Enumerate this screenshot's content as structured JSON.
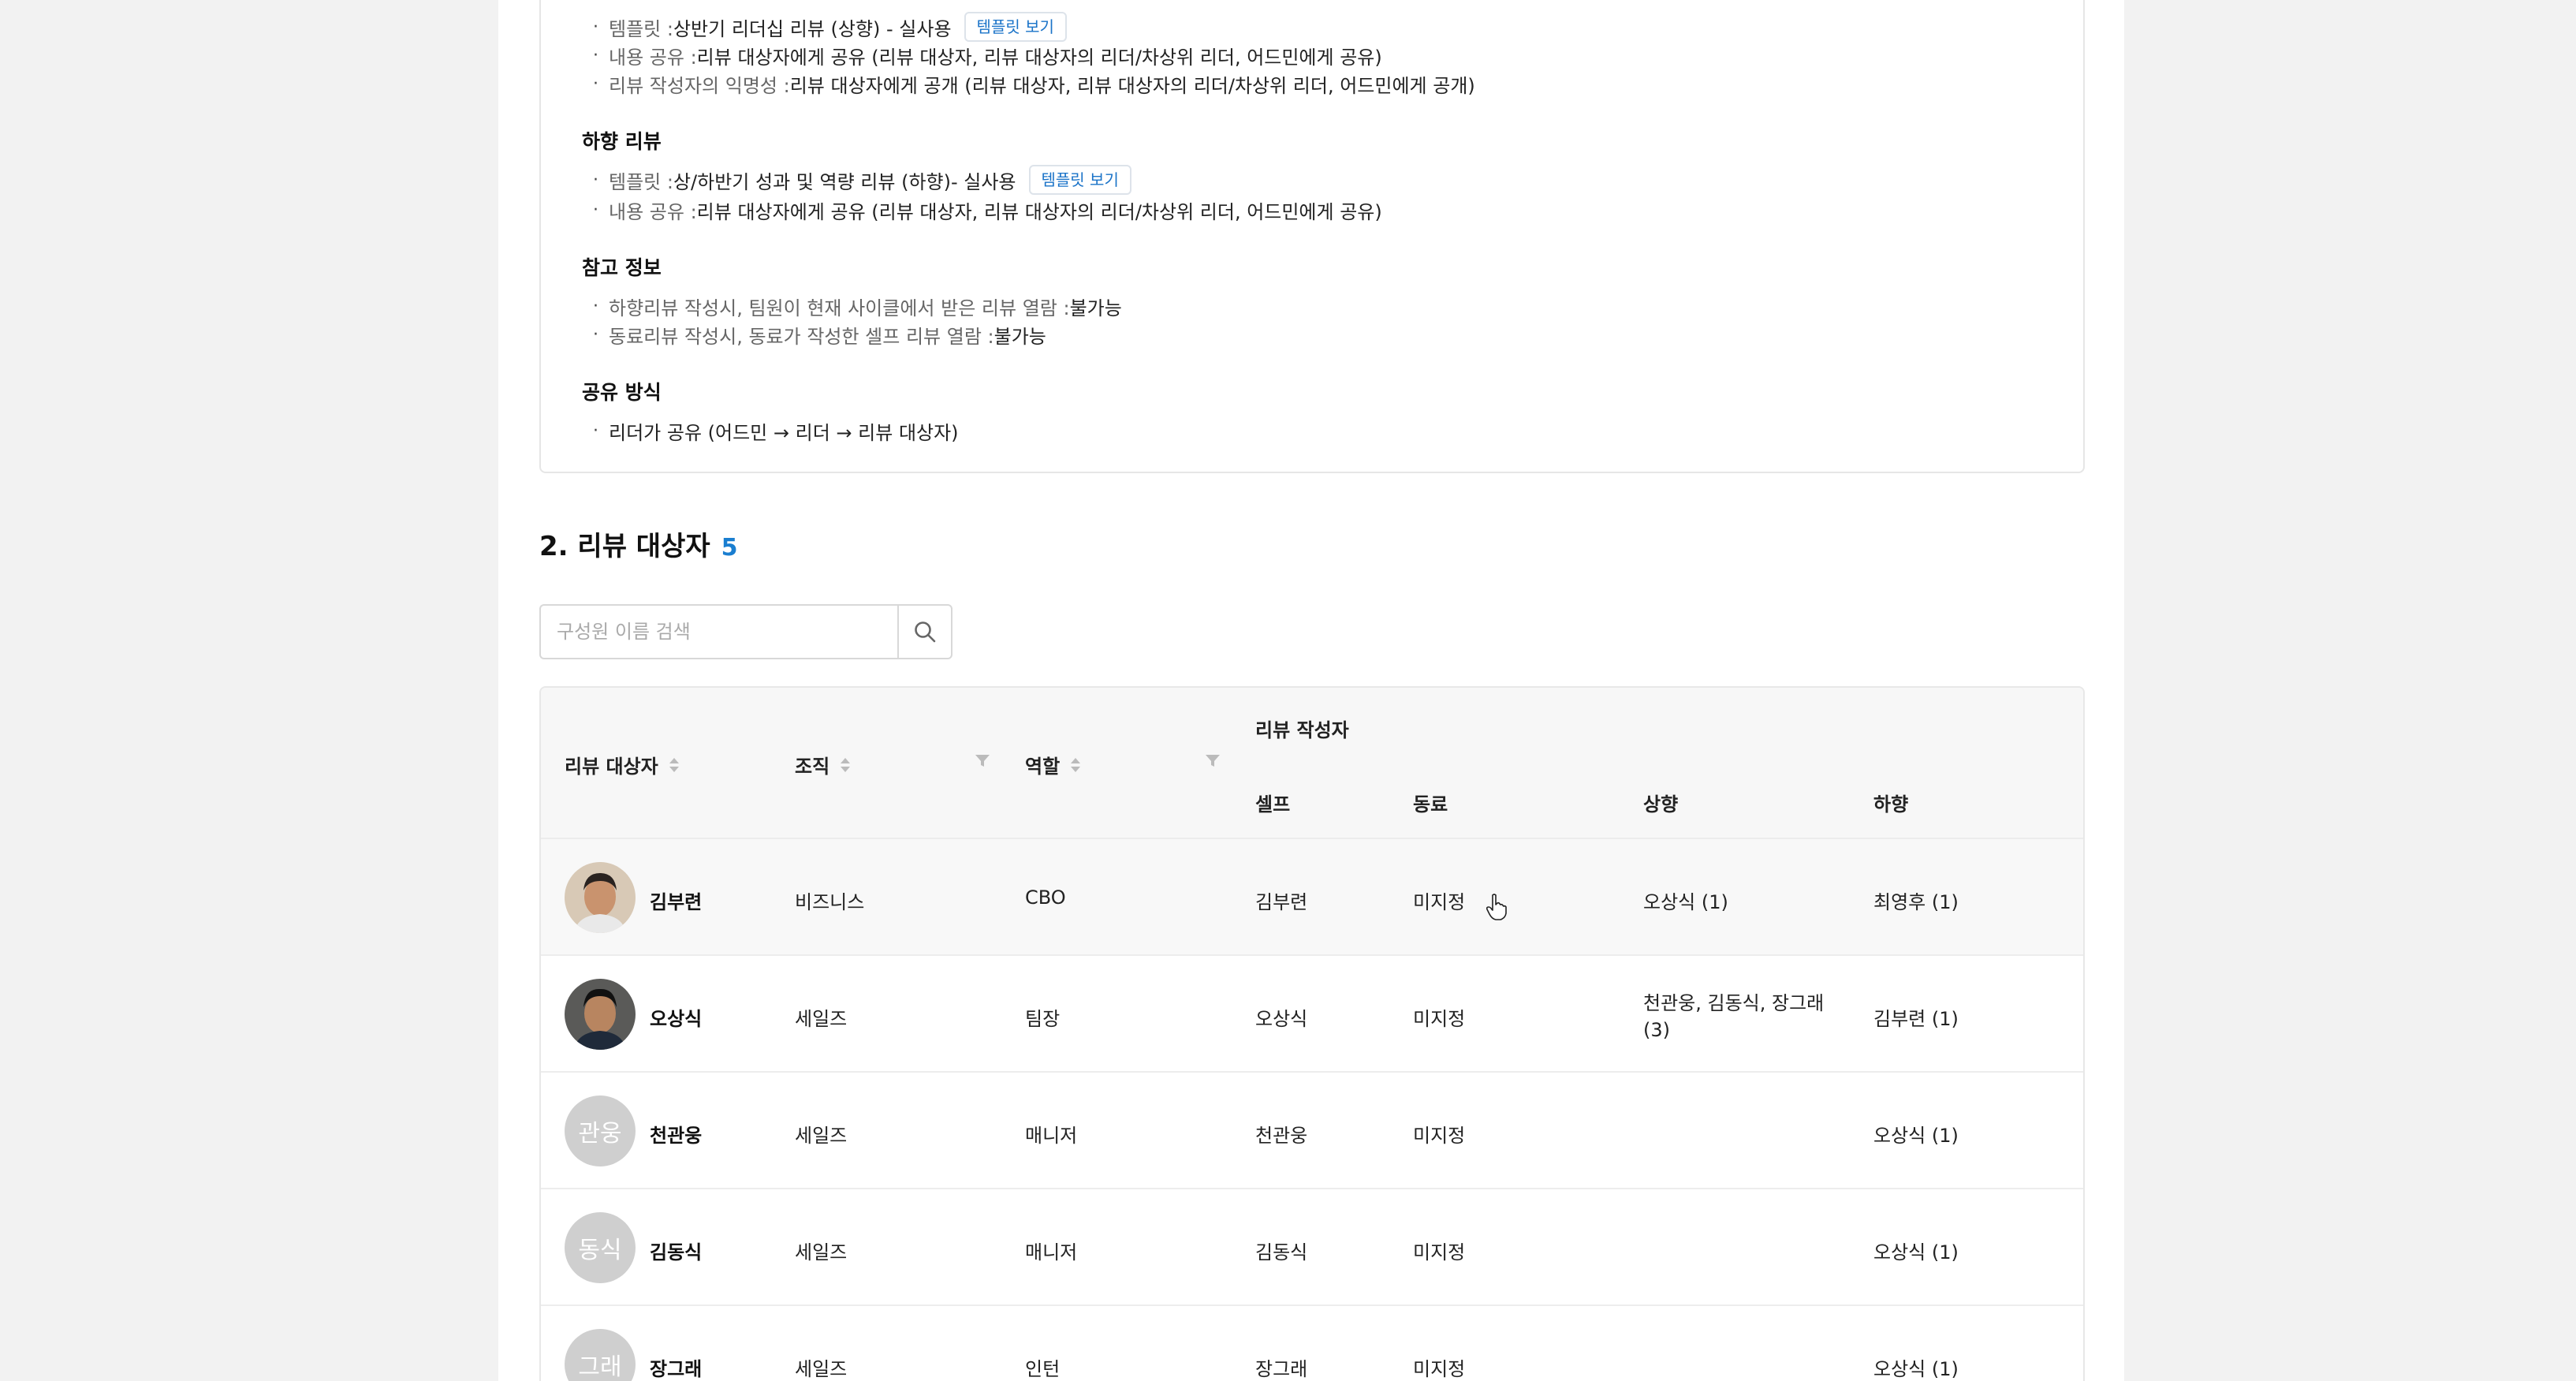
{
  "top_section": {
    "upward_items": [
      {
        "label": "템플릿 : ",
        "value": "상반기 리더십 리뷰 (상향) - 실사용",
        "button": "템플릿 보기"
      },
      {
        "label": "내용 공유 : ",
        "value": "리뷰 대상자에게 공유 (리뷰 대상자, 리뷰 대상자의 리더/차상위 리더, 어드민에게 공유)"
      },
      {
        "label": "리뷰 작성자의 익명성 : ",
        "value": "리뷰 대상자에게 공개 (리뷰 대상자, 리뷰 대상자의 리더/차상위 리더, 어드민에게 공개)"
      }
    ],
    "downward_title": "하향 리뷰",
    "downward_items": [
      {
        "label": "템플릿 : ",
        "value": "상/하반기 성과 및 역량 리뷰 (하향)- 실사용",
        "button": "템플릿 보기"
      },
      {
        "label": "내용 공유 : ",
        "value": "리뷰 대상자에게 공유 (리뷰 대상자, 리뷰 대상자의 리더/차상위 리더, 어드민에게 공유)"
      }
    ],
    "reference_title": "참고 정보",
    "reference_items": [
      {
        "label": "하향리뷰 작성시, 팀원이 현재 사이클에서 받은 리뷰 열람 : ",
        "value": "불가능"
      },
      {
        "label": "동료리뷰 작성시, 동료가 작성한 셀프 리뷰 열람 : ",
        "value": "불가능"
      }
    ],
    "sharing_title": "공유 방식",
    "sharing_items": [
      {
        "value": "리더가 공유 (어드민 → 리더 → 리뷰 대상자)"
      }
    ]
  },
  "reviewees": {
    "title": "2. 리뷰 대상자",
    "count": "5",
    "search_placeholder": "구성원 이름 검색",
    "columns": {
      "reviewee": "리뷰 대상자",
      "org": "조직",
      "role": "역할",
      "writers": "리뷰 작성자",
      "self": "셀프",
      "peer": "동료",
      "upward": "상향",
      "downward": "하향"
    },
    "rows": [
      {
        "name": "김부련",
        "avatar": "photo-1",
        "org": "비즈니스",
        "role": "CBO",
        "self": "김부련",
        "peer": "미지정",
        "upward": "오상식 (1)",
        "upward2": "",
        "downward": "최영후 (1)"
      },
      {
        "name": "오상식",
        "avatar": "photo-2",
        "org": "세일즈",
        "role": "팀장",
        "self": "오상식",
        "peer": "미지정",
        "upward": "천관웅, 김동식, 장그래",
        "upward2": "(3)",
        "downward": "김부련 (1)"
      },
      {
        "name": "천관웅",
        "avatar_initials": "관웅",
        "org": "세일즈",
        "role": "매니저",
        "self": "천관웅",
        "peer": "미지정",
        "upward": "",
        "upward2": "",
        "downward": "오상식 (1)"
      },
      {
        "name": "김동식",
        "avatar_initials": "동식",
        "org": "세일즈",
        "role": "매니저",
        "self": "김동식",
        "peer": "미지정",
        "upward": "",
        "upward2": "",
        "downward": "오상식 (1)"
      },
      {
        "name": "장그래",
        "avatar_initials": "그래",
        "org": "세일즈",
        "role": "인턴",
        "self": "장그래",
        "peer": "미지정",
        "upward": "",
        "upward2": "",
        "downward": "오상식 (1)"
      }
    ]
  },
  "colors": {
    "accent": "#1a7ed0",
    "template_button_text": "#1a73c8",
    "avatar_gray": "#cfcfcf"
  }
}
